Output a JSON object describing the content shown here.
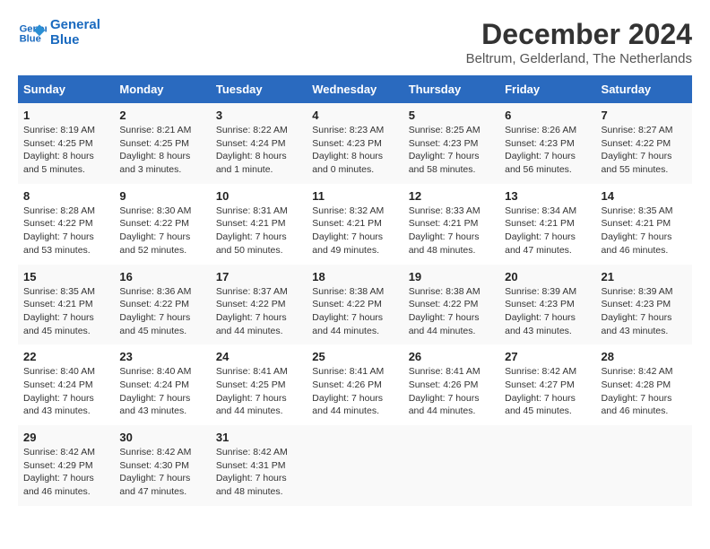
{
  "header": {
    "logo_line1": "General",
    "logo_line2": "Blue",
    "month_title": "December 2024",
    "subtitle": "Beltrum, Gelderland, The Netherlands"
  },
  "weekdays": [
    "Sunday",
    "Monday",
    "Tuesday",
    "Wednesday",
    "Thursday",
    "Friday",
    "Saturday"
  ],
  "weeks": [
    [
      {
        "day": "1",
        "sunrise": "8:19 AM",
        "sunset": "4:25 PM",
        "daylight": "8 hours and 5 minutes."
      },
      {
        "day": "2",
        "sunrise": "8:21 AM",
        "sunset": "4:25 PM",
        "daylight": "8 hours and 3 minutes."
      },
      {
        "day": "3",
        "sunrise": "8:22 AM",
        "sunset": "4:24 PM",
        "daylight": "8 hours and 1 minute."
      },
      {
        "day": "4",
        "sunrise": "8:23 AM",
        "sunset": "4:23 PM",
        "daylight": "8 hours and 0 minutes."
      },
      {
        "day": "5",
        "sunrise": "8:25 AM",
        "sunset": "4:23 PM",
        "daylight": "7 hours and 58 minutes."
      },
      {
        "day": "6",
        "sunrise": "8:26 AM",
        "sunset": "4:23 PM",
        "daylight": "7 hours and 56 minutes."
      },
      {
        "day": "7",
        "sunrise": "8:27 AM",
        "sunset": "4:22 PM",
        "daylight": "7 hours and 55 minutes."
      }
    ],
    [
      {
        "day": "8",
        "sunrise": "8:28 AM",
        "sunset": "4:22 PM",
        "daylight": "7 hours and 53 minutes."
      },
      {
        "day": "9",
        "sunrise": "8:30 AM",
        "sunset": "4:22 PM",
        "daylight": "7 hours and 52 minutes."
      },
      {
        "day": "10",
        "sunrise": "8:31 AM",
        "sunset": "4:21 PM",
        "daylight": "7 hours and 50 minutes."
      },
      {
        "day": "11",
        "sunrise": "8:32 AM",
        "sunset": "4:21 PM",
        "daylight": "7 hours and 49 minutes."
      },
      {
        "day": "12",
        "sunrise": "8:33 AM",
        "sunset": "4:21 PM",
        "daylight": "7 hours and 48 minutes."
      },
      {
        "day": "13",
        "sunrise": "8:34 AM",
        "sunset": "4:21 PM",
        "daylight": "7 hours and 47 minutes."
      },
      {
        "day": "14",
        "sunrise": "8:35 AM",
        "sunset": "4:21 PM",
        "daylight": "7 hours and 46 minutes."
      }
    ],
    [
      {
        "day": "15",
        "sunrise": "8:35 AM",
        "sunset": "4:21 PM",
        "daylight": "7 hours and 45 minutes."
      },
      {
        "day": "16",
        "sunrise": "8:36 AM",
        "sunset": "4:22 PM",
        "daylight": "7 hours and 45 minutes."
      },
      {
        "day": "17",
        "sunrise": "8:37 AM",
        "sunset": "4:22 PM",
        "daylight": "7 hours and 44 minutes."
      },
      {
        "day": "18",
        "sunrise": "8:38 AM",
        "sunset": "4:22 PM",
        "daylight": "7 hours and 44 minutes."
      },
      {
        "day": "19",
        "sunrise": "8:38 AM",
        "sunset": "4:22 PM",
        "daylight": "7 hours and 44 minutes."
      },
      {
        "day": "20",
        "sunrise": "8:39 AM",
        "sunset": "4:23 PM",
        "daylight": "7 hours and 43 minutes."
      },
      {
        "day": "21",
        "sunrise": "8:39 AM",
        "sunset": "4:23 PM",
        "daylight": "7 hours and 43 minutes."
      }
    ],
    [
      {
        "day": "22",
        "sunrise": "8:40 AM",
        "sunset": "4:24 PM",
        "daylight": "7 hours and 43 minutes."
      },
      {
        "day": "23",
        "sunrise": "8:40 AM",
        "sunset": "4:24 PM",
        "daylight": "7 hours and 43 minutes."
      },
      {
        "day": "24",
        "sunrise": "8:41 AM",
        "sunset": "4:25 PM",
        "daylight": "7 hours and 44 minutes."
      },
      {
        "day": "25",
        "sunrise": "8:41 AM",
        "sunset": "4:26 PM",
        "daylight": "7 hours and 44 minutes."
      },
      {
        "day": "26",
        "sunrise": "8:41 AM",
        "sunset": "4:26 PM",
        "daylight": "7 hours and 44 minutes."
      },
      {
        "day": "27",
        "sunrise": "8:42 AM",
        "sunset": "4:27 PM",
        "daylight": "7 hours and 45 minutes."
      },
      {
        "day": "28",
        "sunrise": "8:42 AM",
        "sunset": "4:28 PM",
        "daylight": "7 hours and 46 minutes."
      }
    ],
    [
      {
        "day": "29",
        "sunrise": "8:42 AM",
        "sunset": "4:29 PM",
        "daylight": "7 hours and 46 minutes."
      },
      {
        "day": "30",
        "sunrise": "8:42 AM",
        "sunset": "4:30 PM",
        "daylight": "7 hours and 47 minutes."
      },
      {
        "day": "31",
        "sunrise": "8:42 AM",
        "sunset": "4:31 PM",
        "daylight": "7 hours and 48 minutes."
      },
      null,
      null,
      null,
      null
    ]
  ],
  "labels": {
    "sunrise": "Sunrise:",
    "sunset": "Sunset:",
    "daylight": "Daylight:"
  }
}
